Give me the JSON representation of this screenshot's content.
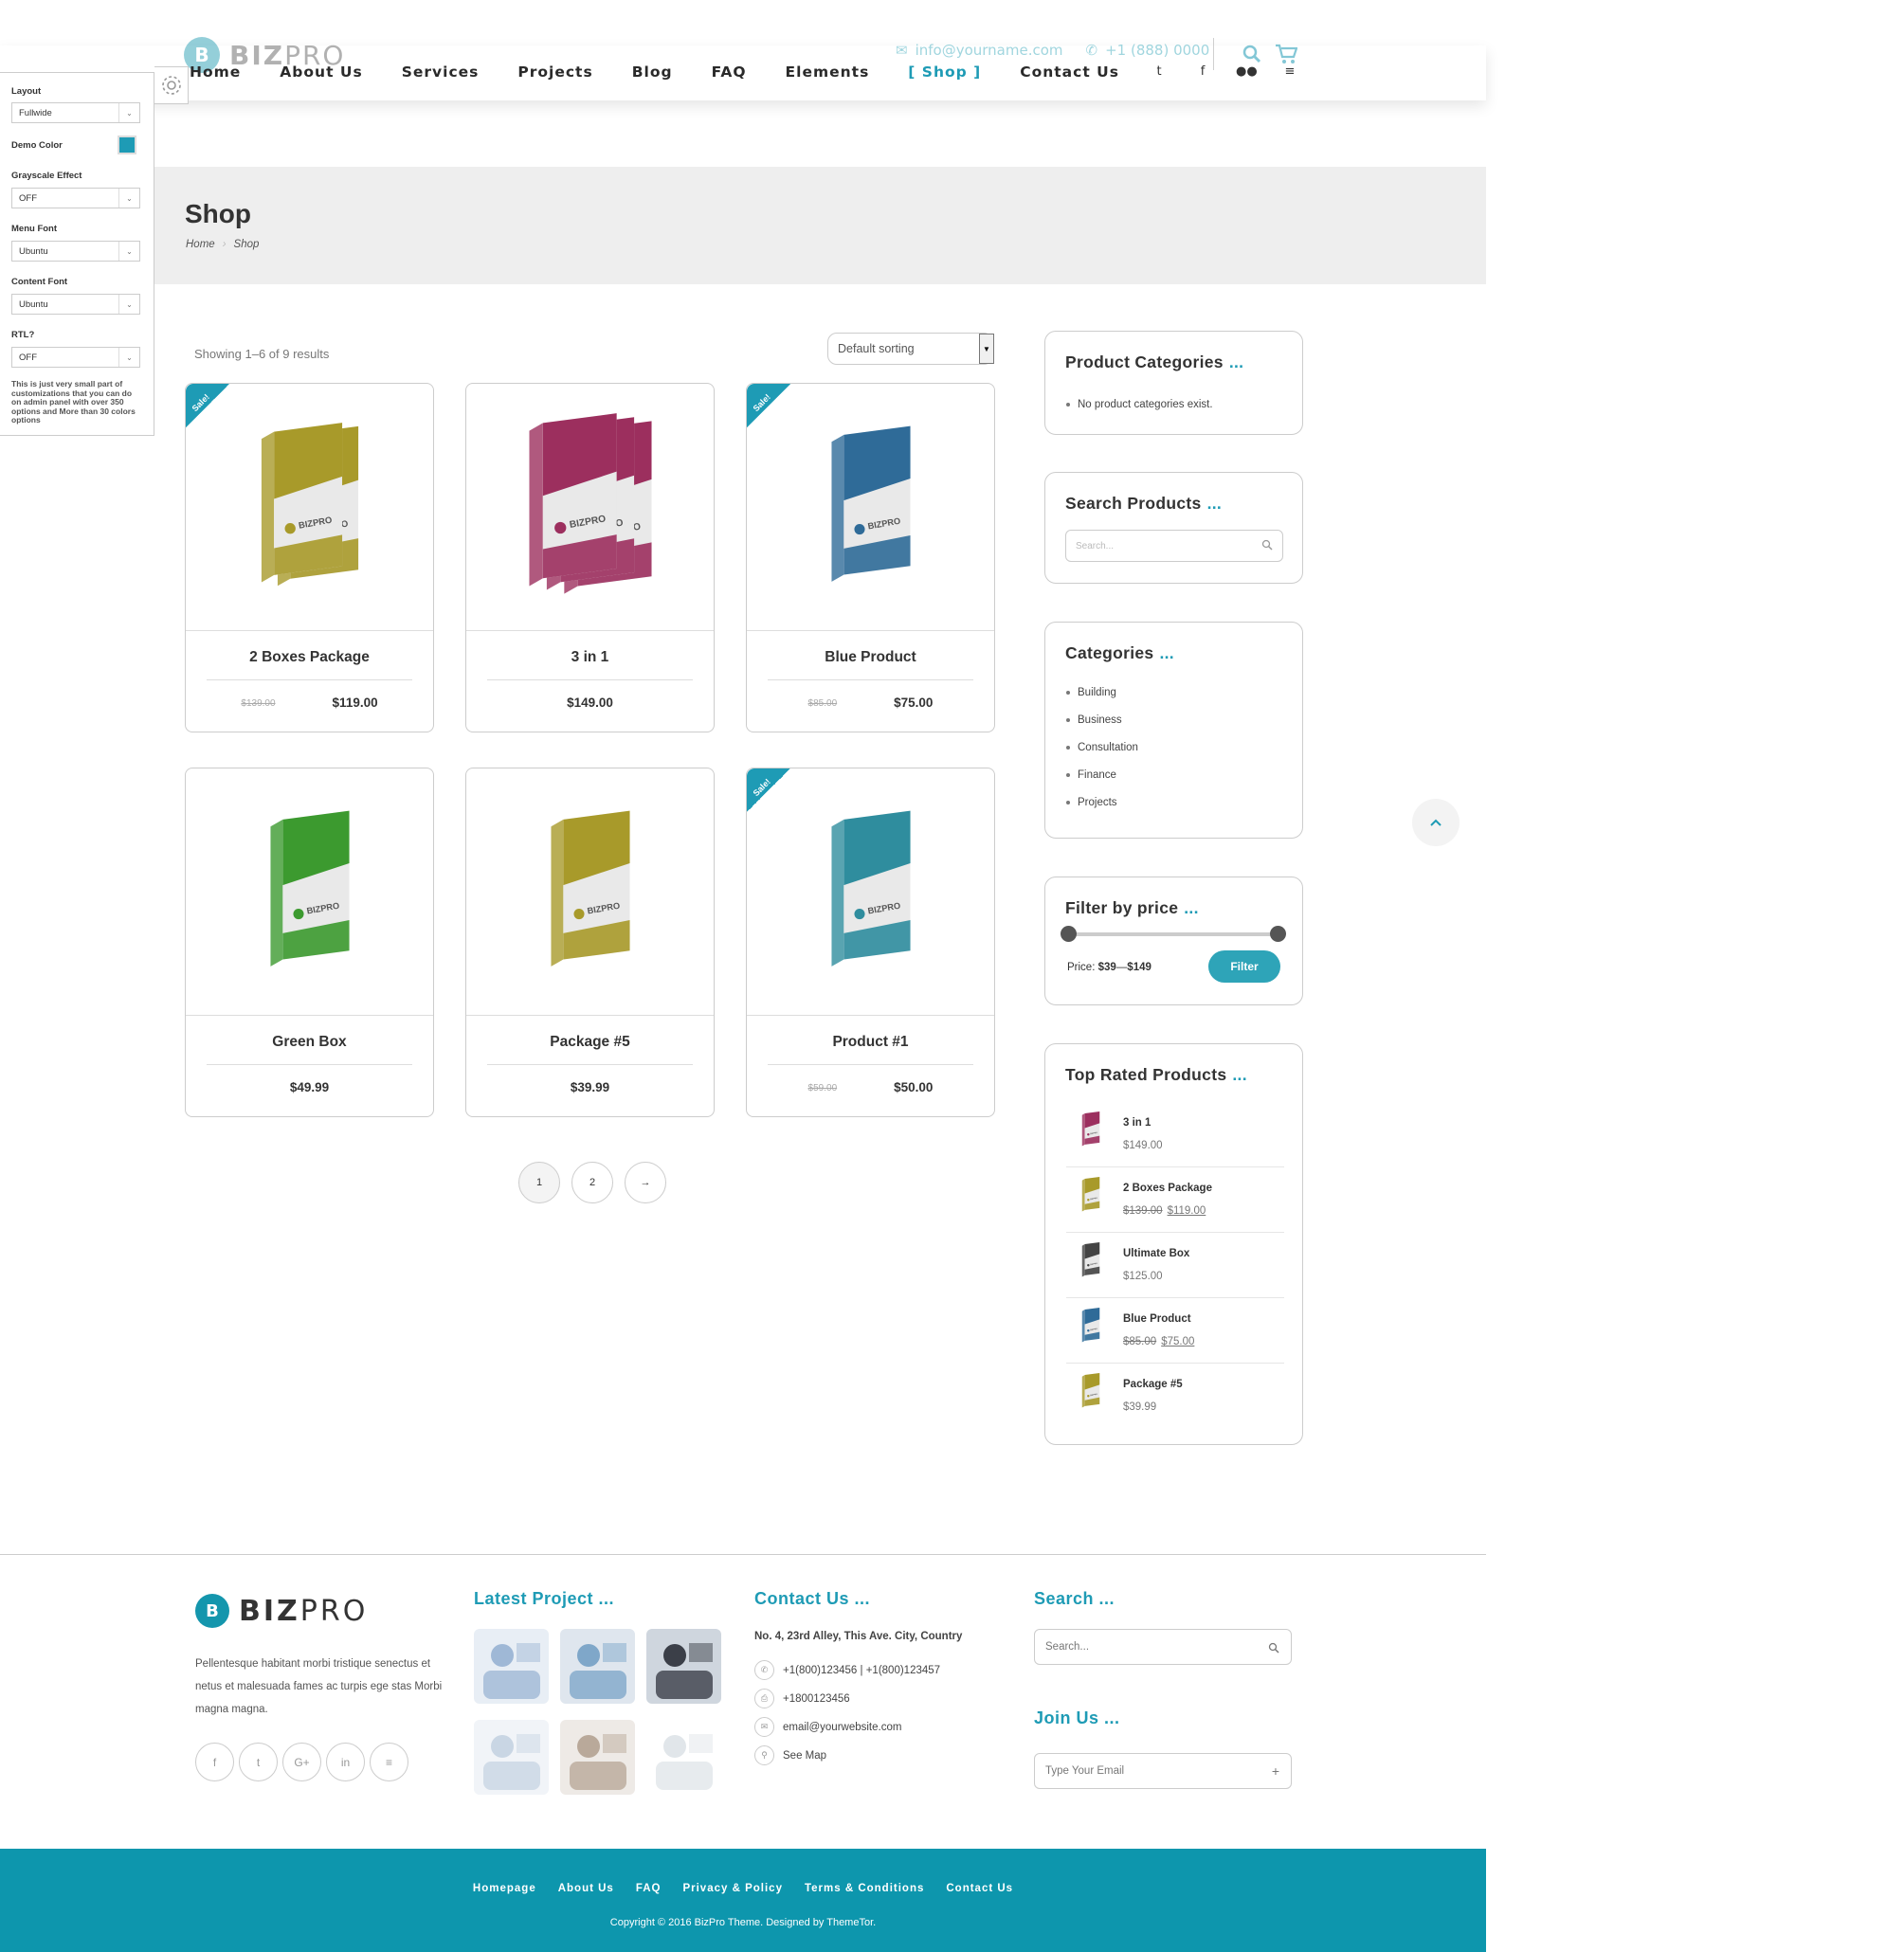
{
  "brand": {
    "mark": "B",
    "name_bold": "BIZ",
    "name_light": "PRO"
  },
  "topbar": {
    "email": "info@yourname.com",
    "phone": "+1 (888) 0000"
  },
  "nav": {
    "items": [
      "Home",
      "About Us",
      "Services",
      "Projects",
      "Blog",
      "FAQ",
      "Elements",
      "[ Shop ]",
      "Contact Us"
    ],
    "active_index": 7
  },
  "social_top": {
    "icons": [
      "twitter-icon",
      "facebook-icon",
      "flickr-icon",
      "rss-icon"
    ],
    "glyphs": [
      "t",
      "f",
      "●●",
      "≡"
    ]
  },
  "customizer": {
    "layout_label": "Layout",
    "layout_value": "Fullwide",
    "demo_color_label": "Demo Color",
    "demo_color": "#1e9bb5",
    "grayscale_label": "Grayscale Effect",
    "grayscale_value": "OFF",
    "menu_font_label": "Menu Font",
    "menu_font_value": "Ubuntu",
    "content_font_label": "Content Font",
    "content_font_value": "Ubuntu",
    "rtl_label": "RTL?",
    "rtl_value": "OFF",
    "note": "This is just very small part of customizations that you can do on admin panel with over 350 options and More than 30 colors options"
  },
  "banner": {
    "title": "Shop",
    "crumb_home": "Home",
    "crumb_sep": "›",
    "crumb_current": "Shop"
  },
  "shop": {
    "results": "Showing 1–6 of 9 results",
    "sorting": "Default sorting",
    "sale_label": "Sale!",
    "products": [
      {
        "name": "2 Boxes Package",
        "old": "$139.00",
        "price": "$119.00",
        "sale": true,
        "color": "#a89a2a",
        "boxes": 2
      },
      {
        "name": "3 in 1",
        "old": "",
        "price": "$149.00",
        "sale": false,
        "color": "#9c2f5e",
        "boxes": 3
      },
      {
        "name": "Blue Product",
        "old": "$85.00",
        "price": "$75.00",
        "sale": true,
        "color": "#2f6b98",
        "boxes": 1
      },
      {
        "name": "Green Box",
        "old": "",
        "price": "$49.99",
        "sale": false,
        "color": "#3c9a2f",
        "boxes": 1
      },
      {
        "name": "Package #5",
        "old": "",
        "price": "$39.99",
        "sale": false,
        "color": "#a89a2a",
        "boxes": 1
      },
      {
        "name": "Product #1",
        "old": "$59.00",
        "price": "$50.00",
        "sale": true,
        "color": "#2f8d9e",
        "boxes": 1
      }
    ],
    "pages": [
      "1",
      "2",
      "→"
    ]
  },
  "sidebar": {
    "cat_title": "Product Categories",
    "no_cats": "No product categories exist.",
    "search_title": "Search Products",
    "search_placeholder": "Search...",
    "categories_title": "Categories",
    "categories": [
      "Building",
      "Business",
      "Consultation",
      "Finance",
      "Projects"
    ],
    "filter_title": "Filter by price",
    "price_prefix": "Price:",
    "price_min": "$39",
    "price_sep": "—",
    "price_max": "$149",
    "filter_button": "Filter",
    "top_title": "Top Rated Products",
    "dots": "...",
    "top_rated": [
      {
        "name": "3 in 1",
        "old": "",
        "price": "$149.00",
        "color": "#9c2f5e"
      },
      {
        "name": "2 Boxes Package",
        "old": "$139.00",
        "price": "$119.00",
        "color": "#a89a2a"
      },
      {
        "name": "Ultimate Box",
        "old": "",
        "price": "$125.00",
        "color": "#444444"
      },
      {
        "name": "Blue Product",
        "old": "$85.00",
        "price": "$75.00",
        "color": "#2f6b98"
      },
      {
        "name": "Package #5",
        "old": "",
        "price": "$39.99",
        "color": "#a89a2a"
      }
    ]
  },
  "footer": {
    "about": "Pellentesque habitant morbi tristique senectus et netus et malesuada fames ac turpis ege stas Morbi magna magna.",
    "social": [
      {
        "icon": "facebook-icon",
        "glyph": "f"
      },
      {
        "icon": "twitter-icon",
        "glyph": "t"
      },
      {
        "icon": "google-plus-icon",
        "glyph": "G+"
      },
      {
        "icon": "linkedin-icon",
        "glyph": "in"
      },
      {
        "icon": "rss-icon",
        "glyph": "≡"
      }
    ],
    "latest_title": "Latest Project ...",
    "contact_title": "Contact Us ...",
    "address": "No. 4, 23rd Alley, This Ave. City, Country",
    "phones": "+1(800)123456   |  +1(800)123457",
    "fax": "+1800123456",
    "email": "email@yourwebsite.com",
    "map": "See Map",
    "search_title": "Search ...",
    "search_placeholder": "Search...",
    "join_title": "Join Us ...",
    "join_placeholder": "Type Your Email",
    "links": [
      "Homepage",
      "About Us",
      "FAQ",
      "Privacy & Policy",
      "Terms & Conditions",
      "Contact Us"
    ],
    "copyright": "Copyright © 2016 BizPro Theme. Designed by ThemeTor."
  }
}
